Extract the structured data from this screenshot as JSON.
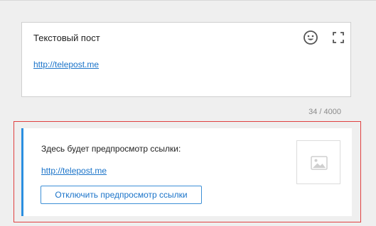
{
  "editor": {
    "text": "Текстовый пост",
    "link": "http://telepost.me"
  },
  "counter": "34 / 4000",
  "preview": {
    "title": "Здесь будет предпросмотр ссылки:",
    "link": "http://telepost.me",
    "disable_button_label": "Отключить предпросмотр ссылки",
    "thumbnail_icon": "image-placeholder-icon"
  },
  "icons": {
    "emoji": "smiley-icon",
    "fullscreen": "fullscreen-icon"
  },
  "colors": {
    "accent": "#2b8fe0",
    "link": "#1a73c9",
    "highlight_frame": "#e04040"
  }
}
